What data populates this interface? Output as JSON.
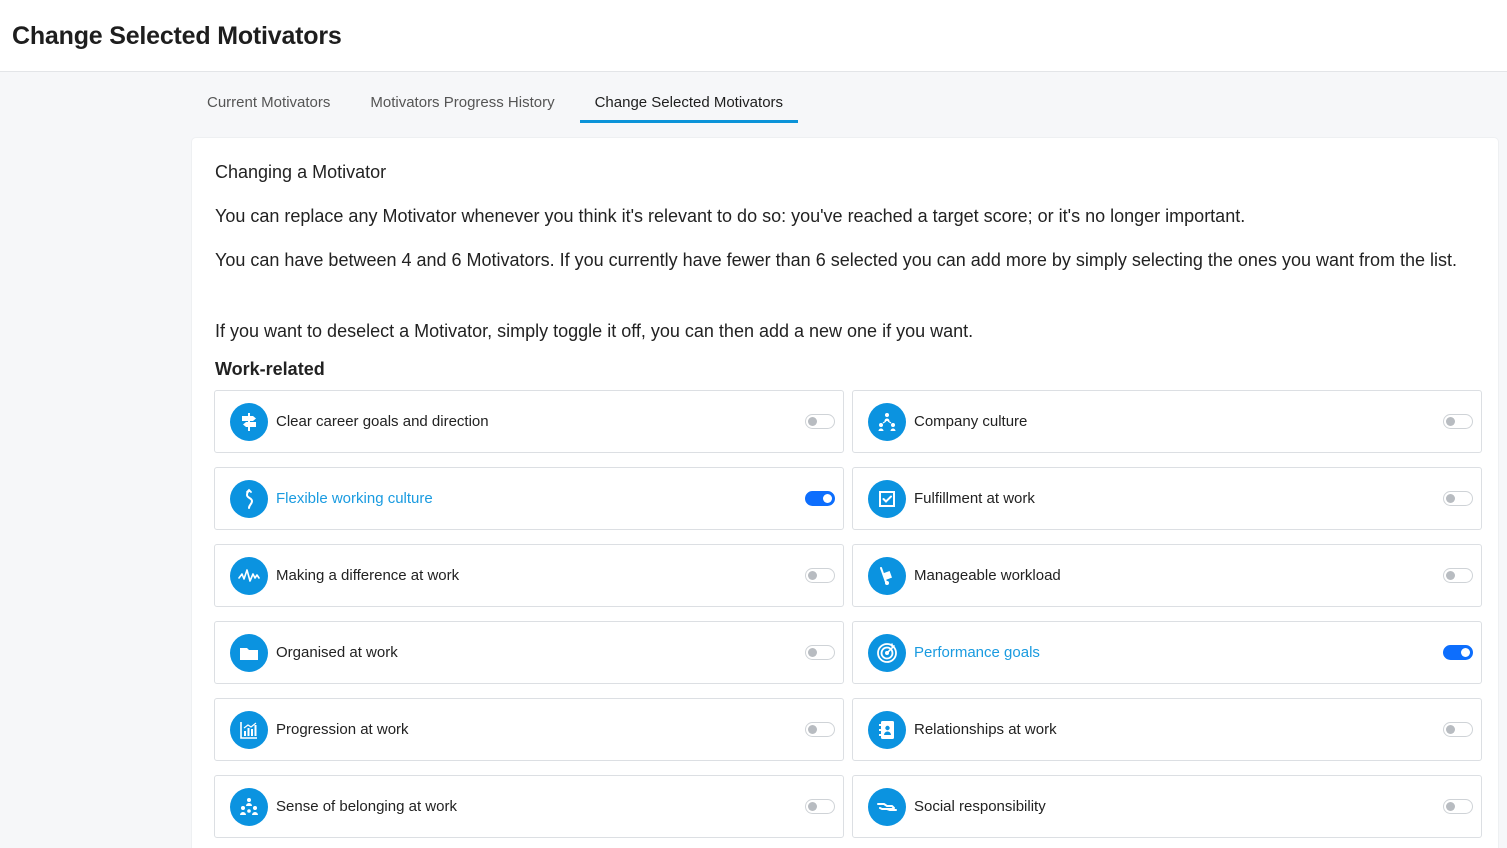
{
  "header": {
    "title": "Change Selected Motivators"
  },
  "tabs": [
    {
      "label": "Current Motivators",
      "active": false
    },
    {
      "label": "Motivators Progress History",
      "active": false
    },
    {
      "label": "Change Selected Motivators",
      "active": true
    }
  ],
  "intro": {
    "heading": "Changing a Motivator",
    "p1": "You can replace any Motivator whenever you think it's relevant to do so: you've reached a target score; or it's no longer important.",
    "p2": "You can have between 4 and 6 Motivators. If you currently have fewer than 6 selected you can add more by simply selecting the ones you want from the list.",
    "p3": "If you want to deselect a Motivator, simply toggle it off, you can then add a new one if you want."
  },
  "section": {
    "title": "Work-related"
  },
  "colors": {
    "accent": "#0b93d8",
    "icon_bg": "#0b93e0",
    "toggle_on": "#0d6efd",
    "selected_text": "#1a9be0"
  },
  "motivators": [
    {
      "label": "Clear career goals and direction",
      "icon": "signpost-icon",
      "selected": false
    },
    {
      "label": "Company culture",
      "icon": "people-network-icon",
      "selected": false
    },
    {
      "label": "Flexible working culture",
      "icon": "winding-path-icon",
      "selected": true
    },
    {
      "label": "Fulfillment at work",
      "icon": "checkbox-icon",
      "selected": false
    },
    {
      "label": "Making a difference at work",
      "icon": "pulse-icon",
      "selected": false
    },
    {
      "label": "Manageable workload",
      "icon": "hand-truck-icon",
      "selected": false
    },
    {
      "label": "Organised at work",
      "icon": "folder-icon",
      "selected": false
    },
    {
      "label": "Performance goals",
      "icon": "target-icon",
      "selected": true
    },
    {
      "label": "Progression at work",
      "icon": "bar-chart-icon",
      "selected": false
    },
    {
      "label": "Relationships at work",
      "icon": "contact-book-icon",
      "selected": false
    },
    {
      "label": "Sense of belonging at work",
      "icon": "group-icon",
      "selected": false
    },
    {
      "label": "Social responsibility",
      "icon": "handshake-icon",
      "selected": false
    }
  ]
}
